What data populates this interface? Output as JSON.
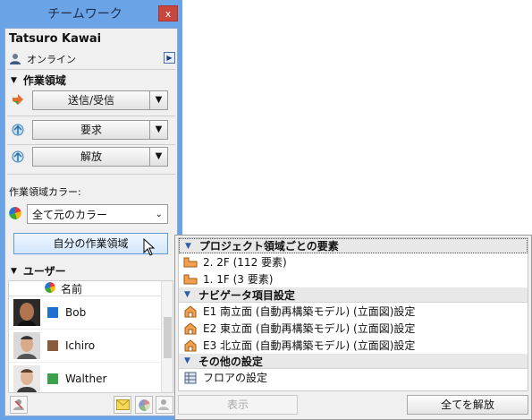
{
  "window": {
    "title": "チームワーク",
    "close_glyph": "x"
  },
  "user": {
    "name": "Tatsuro Kawai",
    "status": "オンライン"
  },
  "workspace": {
    "heading": "作業領域",
    "actions": [
      {
        "label": "送信/受信",
        "icon": "send-receive-icon"
      },
      {
        "label": "要求",
        "icon": "request-icon"
      },
      {
        "label": "解放",
        "icon": "release-icon"
      }
    ],
    "color_label": "作業領域カラー:",
    "color_value": "全て元のカラー",
    "my_workspace_button": "自分の作業領域"
  },
  "users": {
    "heading": "ユーザー",
    "column_name": "名前",
    "list": [
      {
        "name": "Bob",
        "color": "#1f6fcf"
      },
      {
        "name": "Ichiro",
        "color": "#8a5a3c"
      },
      {
        "name": "Walther",
        "color": "#3aa04a"
      }
    ]
  },
  "popup": {
    "groups": [
      {
        "title": "プロジェクト領域ごとの要素",
        "items": [
          "2. 2F (112 要素)",
          "1. 1F (3 要素)"
        ]
      },
      {
        "title": "ナビゲータ項目設定",
        "items": [
          "E1 南立面 (自動再構築モデル) (立面図)設定",
          "E2 東立面 (自動再構築モデル) (立面図)設定",
          "E3 北立面 (自動再構築モデル) (立面図)設定"
        ]
      },
      {
        "title": "その他の設定",
        "items": [
          "フロアの設定"
        ]
      }
    ],
    "show_button": "表示",
    "release_all_button": "全てを解放"
  }
}
